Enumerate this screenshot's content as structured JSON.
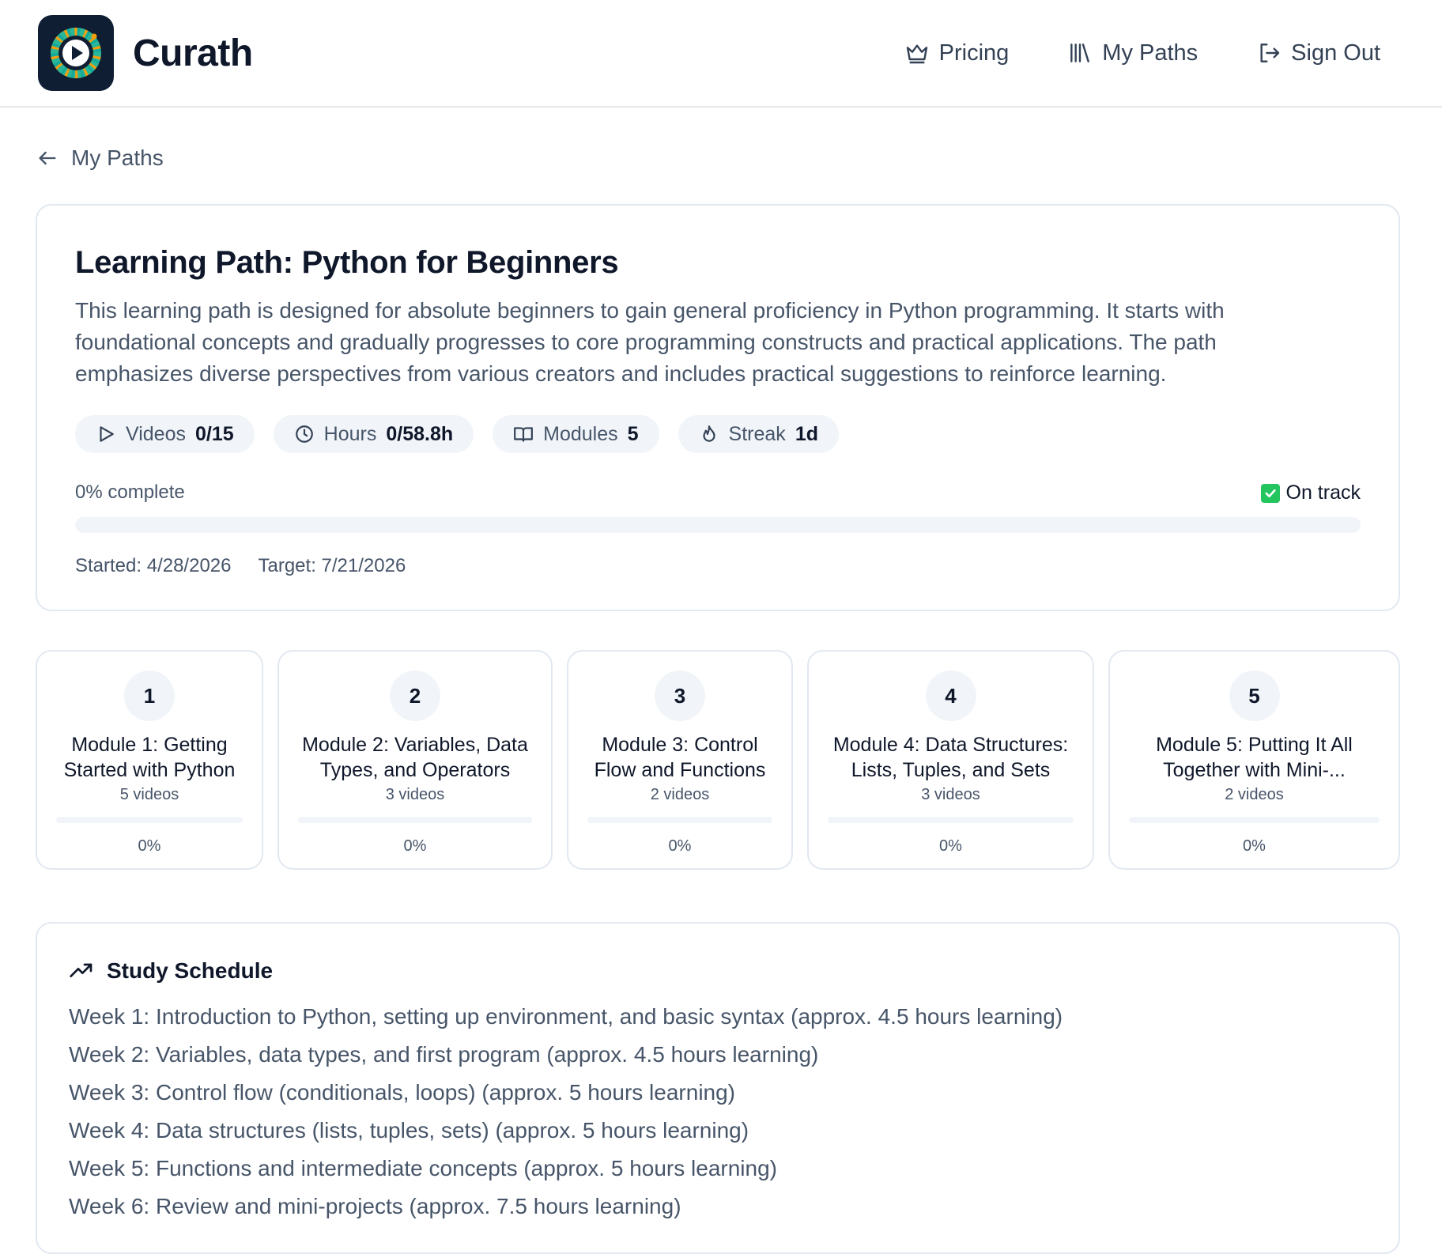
{
  "app": {
    "name": "Curath"
  },
  "nav": {
    "items": [
      {
        "label": "Pricing",
        "icon": "crown-icon"
      },
      {
        "label": "My Paths",
        "icon": "library-icon"
      },
      {
        "label": "Sign Out",
        "icon": "sign-out-icon"
      }
    ]
  },
  "back_link": {
    "label": "My Paths",
    "icon": "arrow-left-icon"
  },
  "path": {
    "title": "Learning Path: Python for Beginners",
    "description": "This learning path is designed for absolute beginners to gain general proficiency in Python programming. It starts with foundational concepts and gradually progresses to core programming constructs and practical applications. The path emphasizes diverse perspectives from various creators and includes practical suggestions to reinforce learning.",
    "stats": [
      {
        "label": "Videos",
        "value": "0/15",
        "icon": "play-icon"
      },
      {
        "label": "Hours",
        "value": "0/58.8h",
        "icon": "clock-icon"
      },
      {
        "label": "Modules",
        "value": "5",
        "icon": "book-open-icon"
      },
      {
        "label": "Streak",
        "value": "1d",
        "icon": "flame-icon"
      }
    ],
    "progress_label": "0% complete",
    "progress_fraction": 0,
    "status": {
      "label": "On track",
      "icon": "check-box-icon",
      "color": "#22c55e"
    },
    "started": "Started: 4/28/2026",
    "target": "Target: 7/21/2026"
  },
  "modules": [
    {
      "number": "1",
      "title": "Module 1: Getting Started with Python",
      "videos": "5 videos",
      "percent": "0%",
      "progress_fraction": 0
    },
    {
      "number": "2",
      "title": "Module 2: Variables, Data Types, and Operators",
      "videos": "3 videos",
      "percent": "0%",
      "progress_fraction": 0
    },
    {
      "number": "3",
      "title": "Module 3: Control Flow and Functions",
      "videos": "2 videos",
      "percent": "0%",
      "progress_fraction": 0
    },
    {
      "number": "4",
      "title": "Module 4: Data Structures: Lists, Tuples, and Sets",
      "videos": "3 videos",
      "percent": "0%",
      "progress_fraction": 0
    },
    {
      "number": "5",
      "title": "Module 5: Putting It All Together with Mini-...",
      "videos": "2 videos",
      "percent": "0%",
      "progress_fraction": 0
    }
  ],
  "schedule": {
    "title": "Study Schedule",
    "icon": "trending-up-icon",
    "weeks": [
      "Week 1: Introduction to Python, setting up environment, and basic syntax (approx. 4.5 hours learning)",
      "Week 2: Variables, data types, and first program (approx. 4.5 hours learning)",
      "Week 3: Control flow (conditionals, loops) (approx. 5 hours learning)",
      "Week 4: Data structures (lists, tuples, sets) (approx. 5 hours learning)",
      "Week 5: Functions and intermediate concepts (approx. 5 hours learning)",
      "Week 6: Review and mini-projects (approx. 7.5 hours learning)"
    ]
  },
  "colors": {
    "text_primary": "#0f172a",
    "text_secondary": "#475569",
    "border": "#e2e8f0",
    "chip_bg": "#f1f5f9",
    "logo_bg": "#0f1e33",
    "on_track_green": "#22c55e"
  }
}
